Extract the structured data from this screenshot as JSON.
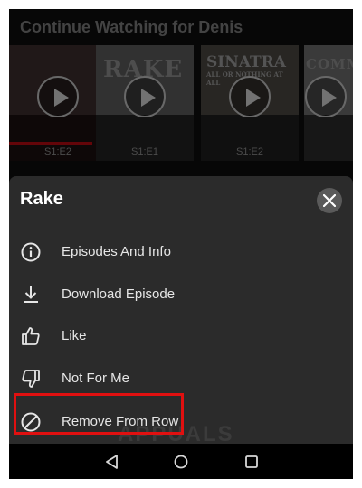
{
  "background": {
    "row_title": "Continue Watching for Denis",
    "tiles": [
      {
        "poster_text": "",
        "episode": "S1:E2",
        "progress": 0.85
      },
      {
        "poster_text": "RAKE",
        "episode": "S1:E1",
        "progress": 0
      },
      {
        "poster_text": "SINATRA",
        "poster_subtext": "ALL OR NOTHING AT ALL",
        "episode": "S1:E2",
        "progress": 0
      },
      {
        "poster_text": "COMM",
        "episode": "",
        "progress": 0
      }
    ]
  },
  "sheet": {
    "title": "Rake",
    "close_icon": "close-icon",
    "items": [
      {
        "label": "Episodes And Info",
        "icon": "info-icon"
      },
      {
        "label": "Download Episode",
        "icon": "download-icon"
      },
      {
        "label": "Like",
        "icon": "thumbs-up-icon"
      },
      {
        "label": "Not For Me",
        "icon": "thumbs-down-icon"
      },
      {
        "label": "Remove From Row",
        "icon": "block-icon"
      }
    ],
    "highlight_color": "#e01010"
  },
  "watermark": "APPUALS",
  "navbar": {
    "back": "back-icon",
    "home": "home-icon",
    "recents": "recents-icon"
  }
}
